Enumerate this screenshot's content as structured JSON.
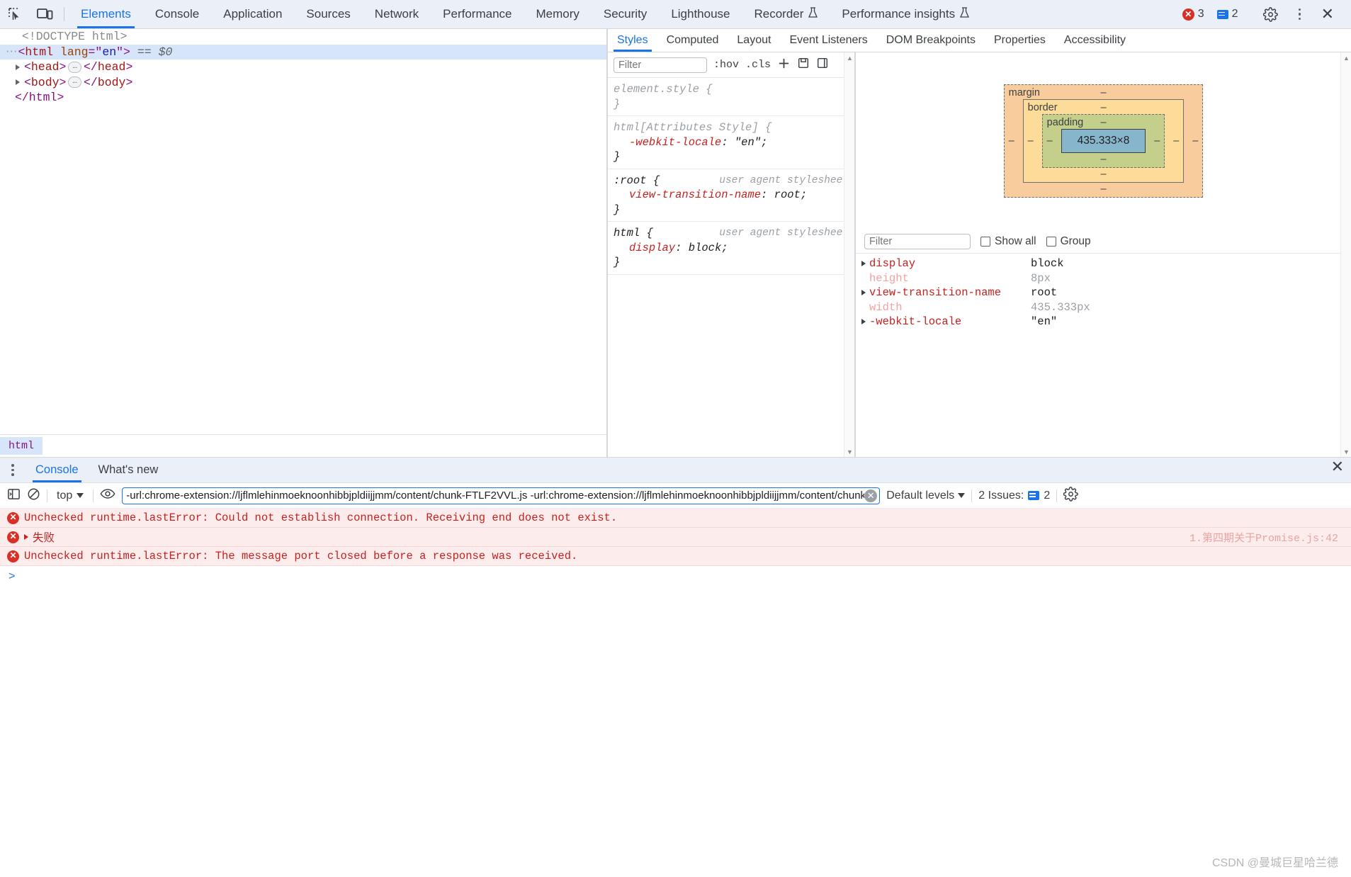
{
  "toolbar": {
    "inspect_icon": "inspect-element-icon",
    "device_icon": "device-toolbar-icon",
    "tabs": [
      {
        "label": "Elements",
        "active": true,
        "experimental": false
      },
      {
        "label": "Console",
        "active": false,
        "experimental": false
      },
      {
        "label": "Application",
        "active": false,
        "experimental": false
      },
      {
        "label": "Sources",
        "active": false,
        "experimental": false
      },
      {
        "label": "Network",
        "active": false,
        "experimental": false
      },
      {
        "label": "Performance",
        "active": false,
        "experimental": false
      },
      {
        "label": "Memory",
        "active": false,
        "experimental": false
      },
      {
        "label": "Security",
        "active": false,
        "experimental": false
      },
      {
        "label": "Lighthouse",
        "active": false,
        "experimental": false
      },
      {
        "label": "Recorder",
        "active": false,
        "experimental": true
      },
      {
        "label": "Performance insights",
        "active": false,
        "experimental": true
      }
    ],
    "error_count": "3",
    "message_count": "2",
    "settings_icon": "gear-icon",
    "more_icon": "kebab-menu-icon",
    "close_icon": "close-icon"
  },
  "dom_tree": {
    "rows": [
      {
        "text": "<!DOCTYPE html>"
      },
      {
        "tag": "html",
        "attr_name": "lang",
        "attr_value": "en",
        "selected_marker": "== $0"
      },
      {
        "tag": "head"
      },
      {
        "tag": "body"
      },
      {
        "text": "</html>"
      }
    ],
    "collapsed_ellipsis": "…"
  },
  "breadcrumb": {
    "items": [
      {
        "label": "html",
        "selected": true
      }
    ]
  },
  "styles": {
    "tabs": [
      {
        "label": "Styles",
        "active": true
      },
      {
        "label": "Computed",
        "active": false
      },
      {
        "label": "Layout",
        "active": false
      },
      {
        "label": "Event Listeners",
        "active": false
      },
      {
        "label": "DOM Breakpoints",
        "active": false
      },
      {
        "label": "Properties",
        "active": false
      },
      {
        "label": "Accessibility",
        "active": false
      }
    ],
    "filter_placeholder": "Filter",
    "filter_value": "",
    "hov_label": ":hov",
    "cls_label": ".cls",
    "new_rule_icon": "plus-icon",
    "computed_style_icon": "computed-sidebar-icon",
    "toggle_icon": "toggle-sidebar-icon",
    "rules": [
      {
        "selector": "element.style",
        "selector_muted": true,
        "origin": "",
        "declarations": []
      },
      {
        "selector": "html[Attributes Style]",
        "selector_muted": true,
        "origin": "",
        "declarations": [
          {
            "property": "-webkit-locale",
            "value": "\"en\""
          }
        ]
      },
      {
        "selector": ":root",
        "selector_muted": false,
        "origin": "user agent stylesheet",
        "declarations": [
          {
            "property": "view-transition-name",
            "value": "root"
          }
        ]
      },
      {
        "selector": "html",
        "selector_muted": false,
        "origin": "user agent stylesheet",
        "declarations": [
          {
            "property": "display",
            "value": "block"
          }
        ]
      }
    ]
  },
  "box_model": {
    "margin_label": "margin",
    "border_label": "border",
    "padding_label": "padding",
    "content_size": "435.333×8",
    "dash": "–",
    "margin_top": "–",
    "margin_right": "–",
    "margin_bottom": "–",
    "margin_left": "–",
    "border_top": "–",
    "border_right": "–",
    "border_bottom": "–",
    "border_left": "–",
    "padding_top": "–",
    "padding_right": "–",
    "padding_bottom": "–",
    "padding_left": "–"
  },
  "computed": {
    "filter_placeholder": "Filter",
    "show_all_label": "Show all",
    "show_all_checked": false,
    "group_label": "Group",
    "group_checked": false,
    "properties": [
      {
        "name": "display",
        "value": "block",
        "inherited": false,
        "expandable": true
      },
      {
        "name": "height",
        "value": "8px",
        "inherited": true,
        "expandable": false
      },
      {
        "name": "view-transition-name",
        "value": "root",
        "inherited": false,
        "expandable": true
      },
      {
        "name": "width",
        "value": "435.333px",
        "inherited": true,
        "expandable": false
      },
      {
        "name": "-webkit-locale",
        "value": "\"en\"",
        "inherited": false,
        "expandable": true
      }
    ]
  },
  "drawer": {
    "more_icon": "kebab-menu-icon",
    "tabs": [
      {
        "label": "Console",
        "active": true
      },
      {
        "label": "What's new",
        "active": false
      }
    ],
    "close_icon": "close-icon"
  },
  "console": {
    "sidebar_icon": "console-sidebar-icon",
    "clear_icon": "clear-console-icon",
    "context": "top",
    "eye_icon": "live-expression-icon",
    "filter_value": "-url:chrome-extension://ljflmlehinmoeknoonhibbjpldiijjmm/content/chunk-FTLF2VVL.js -url:chrome-extension://ljflmlehinmoeknoonhibbjpldiijjmm/content/chunk",
    "filter_placeholder": "Filter",
    "clear_filter_icon": "clear-input-icon",
    "levels_label": "Default levels",
    "issues_label": "2 Issues:",
    "issues_count": "2",
    "settings_icon": "gear-icon",
    "messages": [
      {
        "icon": "error-icon",
        "text": "Unchecked runtime.lastError: Could not establish connection. Receiving end does not exist.",
        "source": "",
        "expandable": false
      },
      {
        "icon": "error-icon",
        "text": "失败",
        "source": "1.第四期关于Promise.js:42",
        "expandable": true
      },
      {
        "icon": "error-icon",
        "text": "Unchecked runtime.lastError: The message port closed before a response was received.",
        "source": "",
        "expandable": false
      }
    ],
    "prompt_symbol": ">"
  },
  "watermark": "CSDN @曼城巨星哈兰德",
  "colors": {
    "accent": "#1a73e8",
    "error": "#d93025",
    "tag": "#a31515",
    "attr_name": "#994500",
    "attr_value": "#1a1aa6",
    "css_property": "#c5221f",
    "toolbar_bg": "#ebeff7",
    "selection_bg": "#d7e5fb"
  }
}
